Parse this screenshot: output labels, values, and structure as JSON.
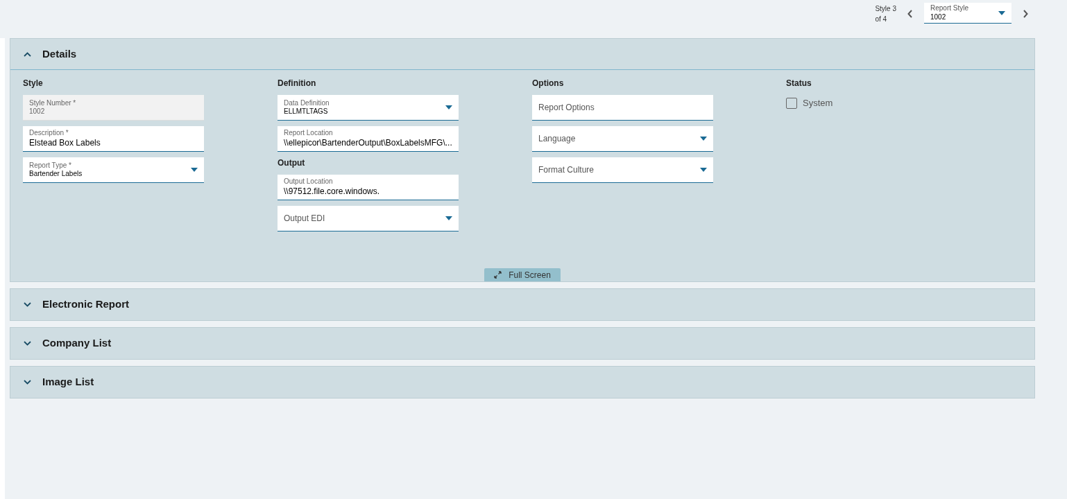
{
  "header": {
    "counter_line_1": "Style 3",
    "counter_line_2": "of 4",
    "report_style": {
      "label": "Report Style",
      "value": "1002"
    }
  },
  "panels": [
    {
      "title": "Details",
      "expanded": true,
      "columns": [
        [
          {
            "title": "Style",
            "fields": [
              {
                "kind": "input",
                "label": "Style Number *",
                "value": "1002",
                "disabled": true
              },
              {
                "kind": "input",
                "label": "Description *",
                "value": "Elstead Box Labels",
                "disabled": false
              },
              {
                "kind": "select",
                "label": "Report Type *",
                "value": "Bartender Labels",
                "disabled": false
              }
            ]
          }
        ],
        [
          {
            "title": "Definition",
            "fields": [
              {
                "kind": "select",
                "label": "Data Definition",
                "value": "ELLMTLTAGS",
                "disabled": false
              },
              {
                "kind": "input",
                "label": "Report Location",
                "value": "\\\\ellepicor\\BartenderOutput\\BoxLabelsMFG\\...",
                "disabled": false
              }
            ]
          },
          {
            "title": "Output",
            "fields": [
              {
                "kind": "input",
                "label": "Output Location",
                "value": "\\\\97512.file.core.windows.",
                "disabled": false
              },
              {
                "kind": "select",
                "placeholder": "Output EDI",
                "disabled": false
              }
            ]
          }
        ],
        [
          {
            "title": "Options",
            "fields": [
              {
                "kind": "input",
                "placeholder": "Report Options",
                "disabled": false
              },
              {
                "kind": "select",
                "placeholder": "Language",
                "disabled": false
              },
              {
                "kind": "select",
                "placeholder": "Format Culture",
                "disabled": false
              }
            ]
          }
        ],
        [
          {
            "title": "Status",
            "fields": [
              {
                "kind": "checkbox",
                "label": "System",
                "checked": false
              }
            ]
          }
        ]
      ],
      "full_screen": "Full Screen"
    },
    {
      "title": "Electronic Report",
      "expanded": false
    },
    {
      "title": "Company List",
      "expanded": false
    },
    {
      "title": "Image List",
      "expanded": false
    }
  ]
}
